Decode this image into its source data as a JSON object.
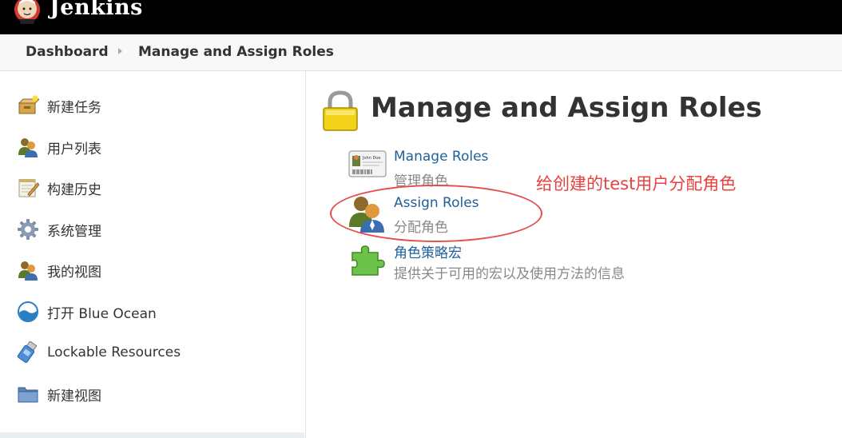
{
  "header": {
    "brand": "Jenkins"
  },
  "breadcrumb": {
    "items": [
      "Dashboard",
      "Manage and Assign Roles"
    ]
  },
  "sidebar": {
    "items": [
      {
        "label": "新建任务",
        "icon": "new-item-icon"
      },
      {
        "label": "用户列表",
        "icon": "users-icon"
      },
      {
        "label": "构建历史",
        "icon": "notepad-icon"
      },
      {
        "label": "系统管理",
        "icon": "gear-icon"
      },
      {
        "label": "我的视图",
        "icon": "users-icon"
      },
      {
        "label": "打开 Blue Ocean",
        "icon": "blue-ocean-icon"
      },
      {
        "label": "Lockable Resources",
        "icon": "usb-drive-icon"
      },
      {
        "label": "新建视图",
        "icon": "folder-icon"
      }
    ]
  },
  "main": {
    "title": "Manage and Assign Roles",
    "entries": [
      {
        "title": "Manage Roles",
        "description": "管理角色",
        "icon": "id-card-icon",
        "icon_text": "John Doe"
      },
      {
        "title": "Assign Roles",
        "description": "分配角色",
        "icon": "users-icon"
      },
      {
        "title": "角色策略宏",
        "description": "提供关于可用的宏以及使用方法的信息",
        "icon": "puzzle-piece-icon"
      }
    ],
    "annotation": "给创建的test用户分配角色"
  },
  "colors": {
    "header_bg": "#000000",
    "link": "#1f5f99",
    "annotation": "#e8423f"
  }
}
